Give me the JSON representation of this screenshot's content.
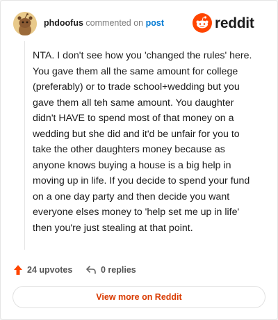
{
  "header": {
    "username": "phdoofus",
    "action_text": "commented on",
    "post_link": "post",
    "brand_name": "reddit"
  },
  "comment": {
    "text": "NTA. I don't see how you 'changed the rules' here. You gave them all the same amount for college (preferably) or to trade school+wedding but you gave them all teh same amount. You daughter didn't HAVE to spend most of that money on a wedding but she did and it'd be unfair for you to take the other daughters money because as anyone knows buying a house is a big help in moving up in life. If you decide to spend your fund on a one day party and then decide you want everyone elses money to 'help set me up in life' then you're just stealing at that point."
  },
  "actions": {
    "upvotes": "24 upvotes",
    "replies": "0 replies"
  },
  "footer": {
    "view_more": "View more on Reddit"
  },
  "colors": {
    "brand": "#ff4500",
    "link": "#0079d3",
    "button_text": "#d93a00",
    "upvote": "#ff4500"
  },
  "icons": {
    "avatar": "snoo-avatar",
    "logo": "reddit-logo-icon",
    "upvote": "upvote-arrow-icon",
    "reply": "reply-arrow-icon"
  }
}
